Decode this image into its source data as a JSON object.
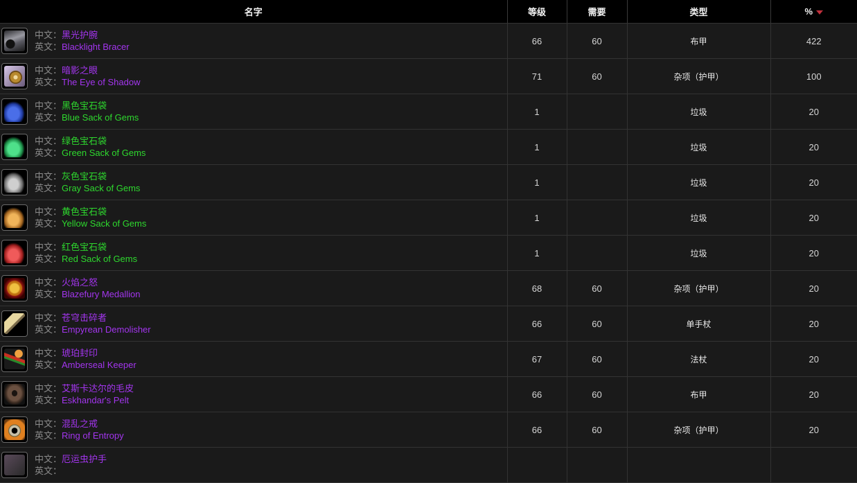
{
  "header": {
    "name": "名字",
    "level": "等级",
    "required": "需要",
    "type": "类型",
    "percent": "%",
    "sort_icon": "sort-desc-icon"
  },
  "labels": {
    "cn": "中文：",
    "en": "英文："
  },
  "colors": {
    "epic": "#a335ee",
    "uncommon": "#2ed82e",
    "sort_arrow": "#c0303c"
  },
  "rows": [
    {
      "cn": "黑光护腕",
      "en": "Blacklight Bracer",
      "quality": "epic",
      "icon": "bracer-icon",
      "level": "66",
      "required": "60",
      "type": "布甲",
      "percent": "422"
    },
    {
      "cn": "暗影之眼",
      "en": "The Eye of Shadow",
      "quality": "epic",
      "icon": "eye-icon",
      "level": "71",
      "required": "60",
      "type": "杂项（护甲）",
      "percent": "100"
    },
    {
      "cn": "黑色宝石袋",
      "en": "Blue Sack of Gems",
      "quality": "uncommon",
      "icon": "blue-sack-icon",
      "level": "1",
      "required": "",
      "type": "垃圾",
      "percent": "20"
    },
    {
      "cn": "绿色宝石袋",
      "en": "Green Sack of Gems",
      "quality": "uncommon",
      "icon": "green-sack-icon",
      "level": "1",
      "required": "",
      "type": "垃圾",
      "percent": "20"
    },
    {
      "cn": "灰色宝石袋",
      "en": "Gray Sack of Gems",
      "quality": "uncommon",
      "icon": "gray-sack-icon",
      "level": "1",
      "required": "",
      "type": "垃圾",
      "percent": "20"
    },
    {
      "cn": "黄色宝石袋",
      "en": "Yellow Sack of Gems",
      "quality": "uncommon",
      "icon": "yellow-sack-icon",
      "level": "1",
      "required": "",
      "type": "垃圾",
      "percent": "20"
    },
    {
      "cn": "红色宝石袋",
      "en": "Red Sack of Gems",
      "quality": "uncommon",
      "icon": "red-sack-icon",
      "level": "1",
      "required": "",
      "type": "垃圾",
      "percent": "20"
    },
    {
      "cn": "火焰之怒",
      "en": "Blazefury Medallion",
      "quality": "epic",
      "icon": "medallion-icon",
      "level": "68",
      "required": "60",
      "type": "杂项（护甲）",
      "percent": "20"
    },
    {
      "cn": "苍穹击碎者",
      "en": "Empyrean Demolisher",
      "quality": "epic",
      "icon": "mace-icon",
      "level": "66",
      "required": "60",
      "type": "单手杖",
      "percent": "20"
    },
    {
      "cn": "琥珀封印",
      "en": "Amberseal Keeper",
      "quality": "epic",
      "icon": "staff-icon",
      "level": "67",
      "required": "60",
      "type": "法杖",
      "percent": "20"
    },
    {
      "cn": "艾斯卡达尔的毛皮",
      "en": "Eskhandar's Pelt",
      "quality": "epic",
      "icon": "pelt-icon",
      "level": "66",
      "required": "60",
      "type": "布甲",
      "percent": "20"
    },
    {
      "cn": "混乱之戒",
      "en": "Ring of Entropy",
      "quality": "epic",
      "icon": "ring-icon",
      "level": "66",
      "required": "60",
      "type": "杂项（护甲）",
      "percent": "20"
    },
    {
      "cn": "厄运虫护手",
      "en": "",
      "quality": "epic",
      "icon": "gauntlet-icon",
      "level": "",
      "required": "",
      "type": "",
      "percent": ""
    }
  ]
}
